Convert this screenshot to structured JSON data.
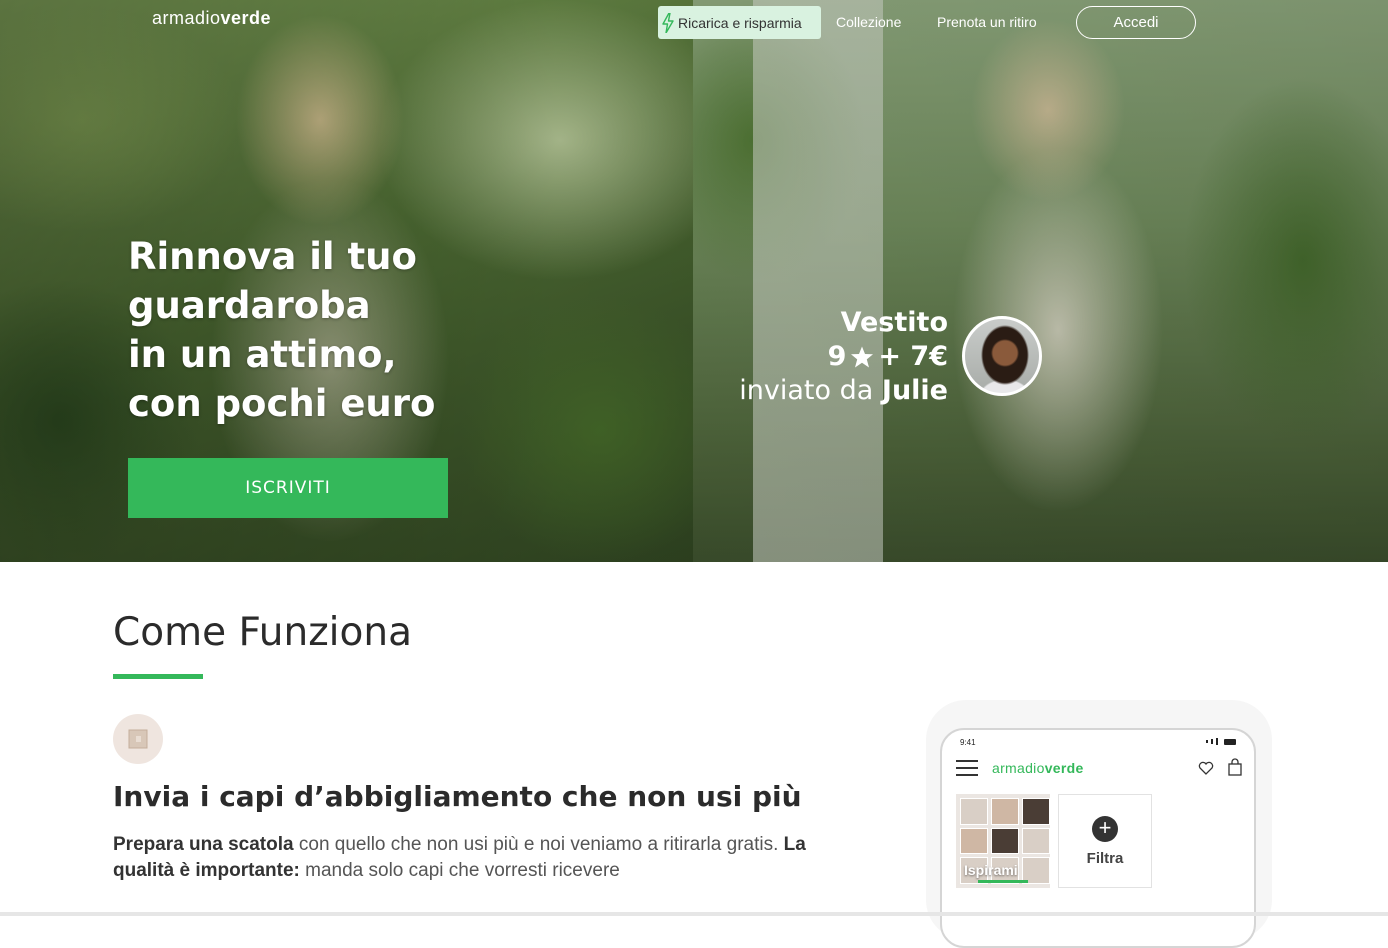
{
  "brand": {
    "logo_light": "armadio",
    "logo_bold": "verde",
    "accent": "#34b85a"
  },
  "nav": {
    "promo": "Ricarica e risparmia",
    "links": [
      "Collezione",
      "Prenota un ritiro"
    ],
    "login": "Accedi"
  },
  "hero": {
    "title_lines": [
      "Rinnova il tuo",
      "guardaroba",
      "in un attimo,",
      "con pochi euro"
    ],
    "cta": "ISCRIVITI",
    "item": {
      "name": "Vestito",
      "stars": "9",
      "plus_price": "+ 7€",
      "sent_by_prefix": "inviato da",
      "sender": "Julie"
    }
  },
  "how_it_works": {
    "title": "Come Funziona",
    "step1": {
      "title": "Invia i capi d’abbigliamento che non usi più",
      "text_bold_1": "Prepara una scatola",
      "text_1": " con quello che non usi più e noi veniamo a ritirarla gratis. ",
      "text_bold_2": "La qualità è importante:",
      "text_2": " manda solo capi che vorresti ricevere"
    }
  },
  "phone": {
    "time": "9:41",
    "logo_light": "armadio",
    "logo_bold": "verde",
    "tile_inspire": "Ispirami",
    "tile_filter": "Filtra"
  }
}
